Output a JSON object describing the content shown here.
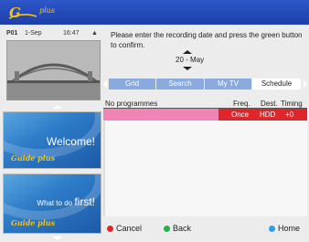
{
  "logo": {
    "text": "G",
    "plus": "plus"
  },
  "preview": {
    "channel": "P01",
    "date": "1-Sep",
    "time": "16:47",
    "lock_icon": "lock-icon"
  },
  "cards": {
    "welcome": "Welcome!",
    "first_small": "What to do ",
    "first_big": "first!",
    "mini_logo": "Guide plus"
  },
  "instruction": "Please enter the recording date and press the green button to confirm.",
  "date_value": "20 - May",
  "tabs": [
    "Grid",
    "Search",
    "My TV",
    "Schedule"
  ],
  "columns": {
    "programmes": "No programmes",
    "freq": "Freq.",
    "dest": "Dest.",
    "timing": "Timing"
  },
  "row": {
    "freq": "Once",
    "dest": "HDD",
    "timing": "+0"
  },
  "footer": {
    "cancel": "Cancel",
    "back": "Back",
    "home": "Home"
  },
  "colors": {
    "accent_red": "#e0262a",
    "accent_green": "#22b14c",
    "accent_blue": "#2fa0e8",
    "tab_blue": "#8aa9dc",
    "banner": "#2e57c9"
  }
}
